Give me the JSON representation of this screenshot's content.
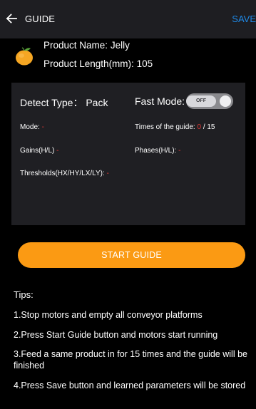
{
  "header": {
    "title": "GUIDE",
    "save_label": "SAVE",
    "back_icon": "arrow-left-icon"
  },
  "product": {
    "icon": "orange-fruit-icon",
    "name_label": "Product Name:",
    "name_value": "Jelly",
    "length_label": "Product Length(mm):",
    "length_value": "105"
  },
  "panel": {
    "detect_type_label": "Detect Type：",
    "detect_type_value": "Pack",
    "fast_mode_label": "Fast Mode:",
    "fast_mode_state": "OFF",
    "mode_label": "Mode:",
    "mode_value": "-",
    "times_label": "Times of the guide:",
    "times_current": "0",
    "times_total": "/ 15",
    "gains_label": "Gains(H/L)",
    "gains_value": "-",
    "phases_label": "Phases(H/L):",
    "phases_value": "-",
    "thresholds_label": "Thresholds(HX/HY/LX/LY):",
    "thresholds_value": "-"
  },
  "start_button_label": "START GUIDE",
  "tips": {
    "title": "Tips:",
    "items": [
      "1.Stop motors and empty all conveyor platforms",
      "2.Press Start Guide button and motors start running",
      "3.Feed a same product in for 15 times and the guide will be finished",
      "4.Press Save button and learned parameters will be stored"
    ]
  },
  "colors": {
    "accent_orange": "#fb9a13",
    "save_blue": "#1e88e5",
    "value_red": "#e53935",
    "header_bg": "#1e1e22",
    "panel_bg": "#1f1f23"
  }
}
